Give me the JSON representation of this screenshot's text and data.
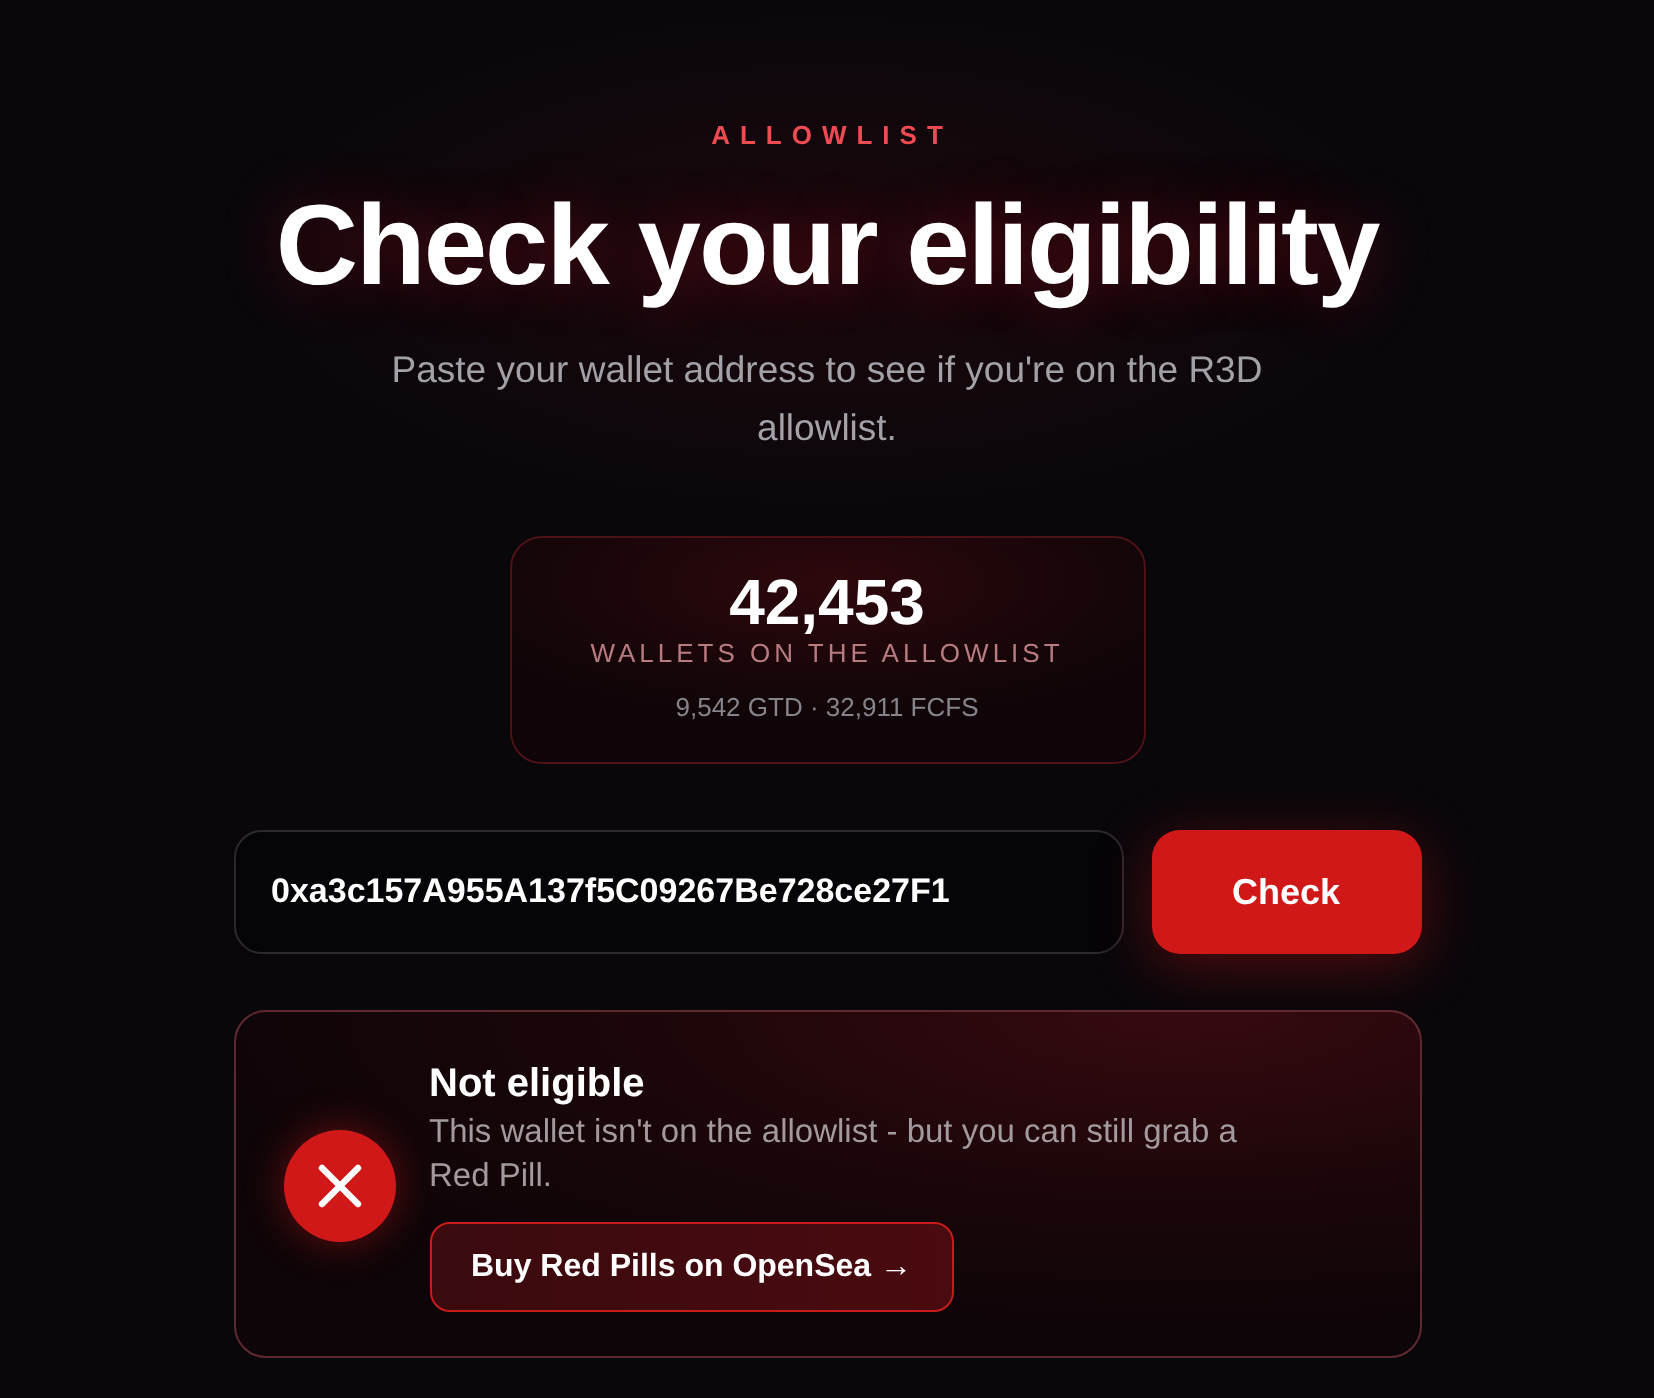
{
  "header": {
    "eyebrow": "ALLOWLIST",
    "title": "Check your eligibility",
    "subtitle": "Paste your wallet address to see if you're on the R3D allowlist."
  },
  "stats": {
    "total": "42,453",
    "label": "WALLETS ON THE ALLOWLIST",
    "breakdown": "9,542 GTD · 32,911 FCFS"
  },
  "checker": {
    "value": "0xa3c157A955A137f5C09267Be728ce27F1",
    "button": "Check"
  },
  "result": {
    "eligible": false,
    "title": "Not eligible",
    "message": "This wallet isn't on the allowlist - but you can still grab a Red Pill.",
    "button": "Buy Red Pills on OpenSea →"
  }
}
